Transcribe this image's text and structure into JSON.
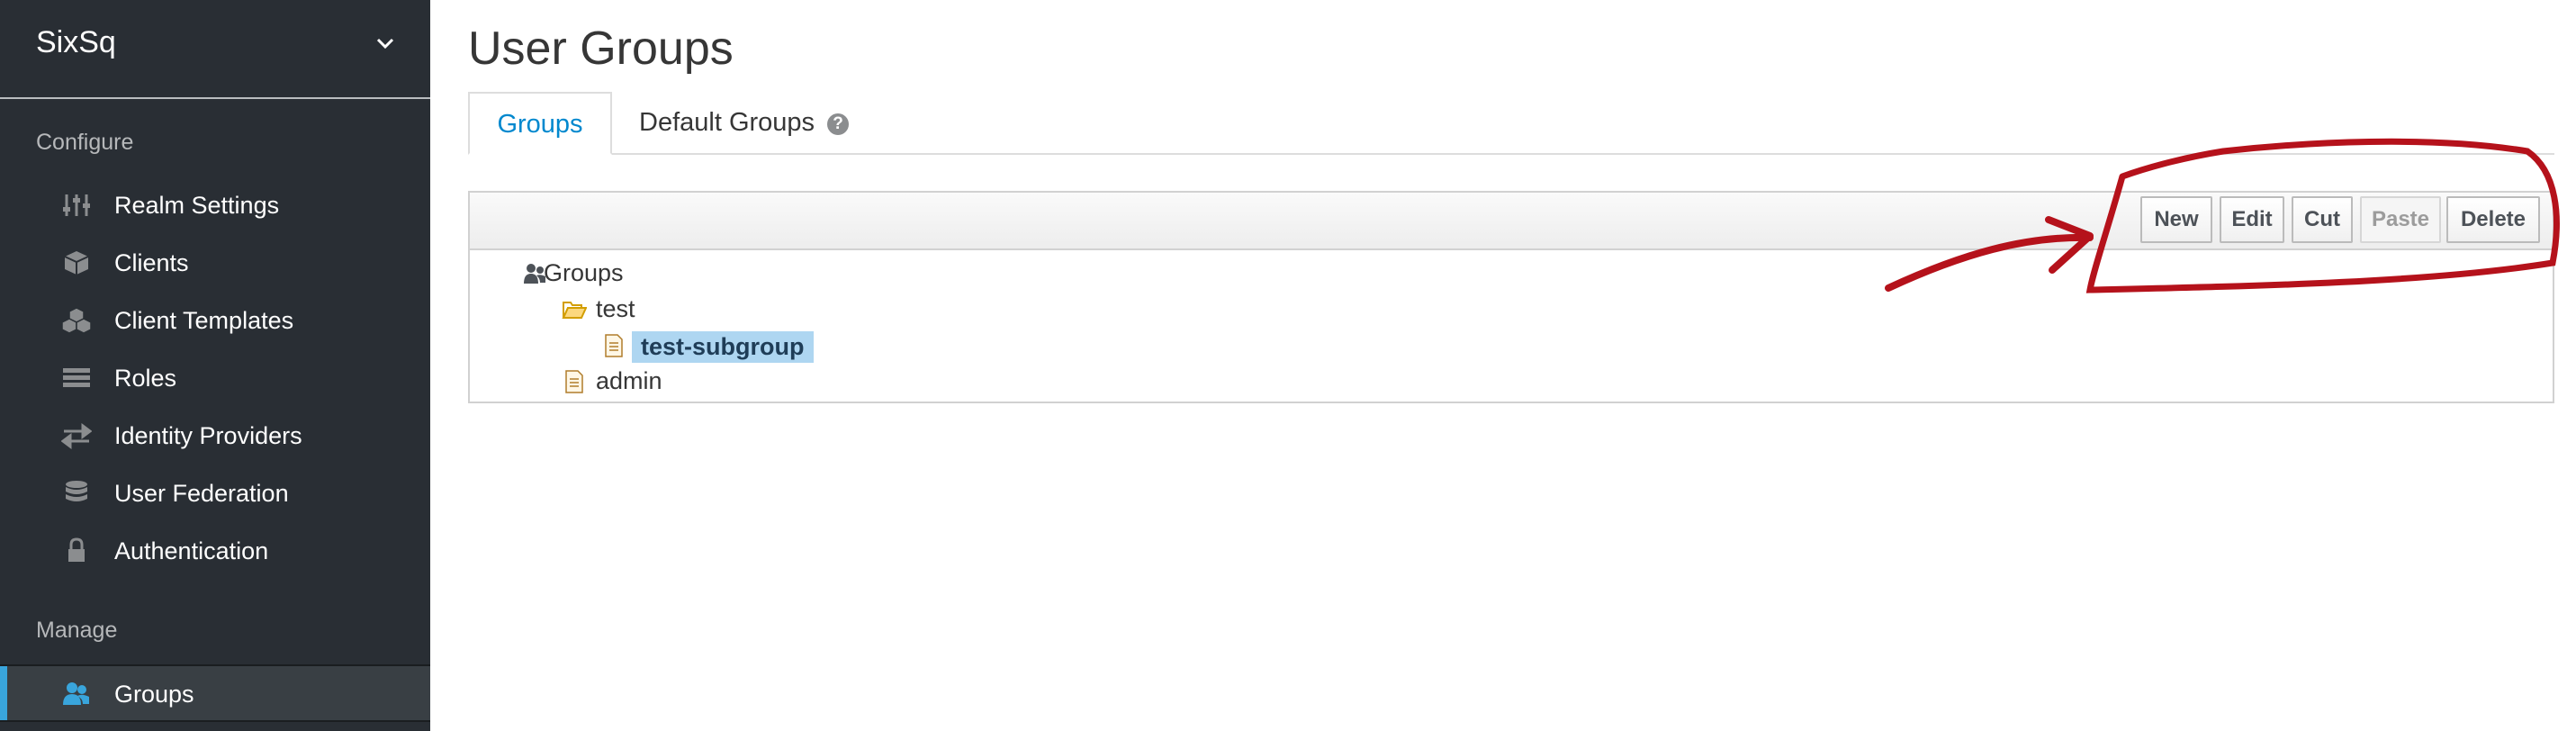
{
  "sidebar": {
    "realm": "SixSq",
    "configure_heading": "Configure",
    "configure_items": [
      {
        "label": "Realm Settings",
        "icon": "sliders-icon"
      },
      {
        "label": "Clients",
        "icon": "cube-icon"
      },
      {
        "label": "Client Templates",
        "icon": "cubes-icon"
      },
      {
        "label": "Roles",
        "icon": "list-icon"
      },
      {
        "label": "Identity Providers",
        "icon": "exchange-icon"
      },
      {
        "label": "User Federation",
        "icon": "database-icon"
      },
      {
        "label": "Authentication",
        "icon": "lock-icon"
      }
    ],
    "manage_heading": "Manage",
    "manage_items": [
      {
        "label": "Groups",
        "icon": "users-icon",
        "active": true
      }
    ]
  },
  "main": {
    "title": "User Groups",
    "tabs": [
      {
        "label": "Groups",
        "active": true
      },
      {
        "label": "Default Groups",
        "help": "?"
      }
    ],
    "toolbar": {
      "new": "New",
      "edit": "Edit",
      "cut": "Cut",
      "paste": "Paste",
      "delete": "Delete"
    },
    "tree": [
      {
        "label": "Groups",
        "icon": "users-icon",
        "depth": 0
      },
      {
        "label": "test",
        "icon": "folder-open-icon",
        "depth": 1
      },
      {
        "label": "test-subgroup",
        "icon": "file-icon",
        "depth": 2,
        "selected": true
      },
      {
        "label": "admin",
        "icon": "file-icon",
        "depth": 1
      }
    ]
  },
  "colors": {
    "sidebar_bg": "#292e34",
    "accent": "#39a5dc",
    "tab_active": "#0088ce",
    "selection": "#aed6f1",
    "annotation": "#b5121b"
  }
}
